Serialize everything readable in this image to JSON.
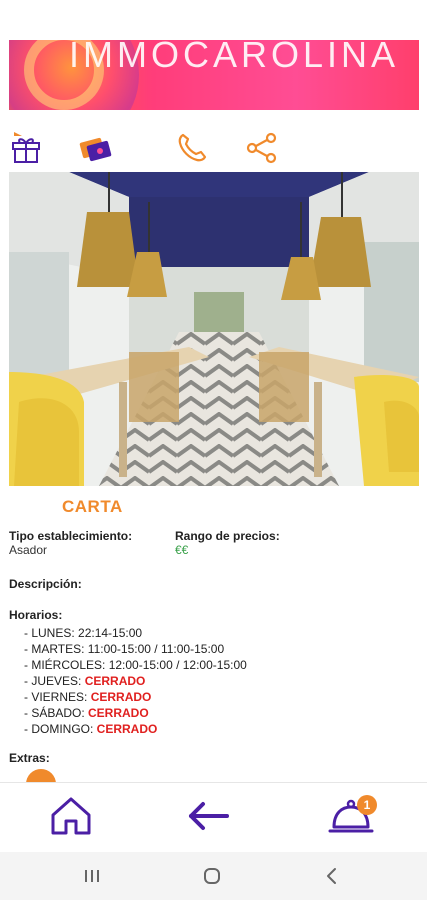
{
  "banner": {
    "brand_text": "IMMOCAROLINA"
  },
  "actions": {
    "gift_icon": "gift-icon",
    "cards_icon": "loyalty-card-icon",
    "phone_icon": "phone-icon",
    "share_icon": "share-icon"
  },
  "section_title": "CARTA",
  "details": {
    "type_label": "Tipo establecimiento:",
    "type_value": "Asador",
    "price_label": "Rango de precios:",
    "price_value": "€€",
    "description_label": "Descripción:",
    "hours_label": "Horarios:",
    "hours": [
      {
        "day": "- LUNES: ",
        "time": "22:14-15:00",
        "closed": ""
      },
      {
        "day": "- MARTES: ",
        "time": "11:00-15:00 / 11:00-15:00",
        "closed": ""
      },
      {
        "day": "- MIÉRCOLES: ",
        "time": "12:00-15:00 / 12:00-15:00",
        "closed": ""
      },
      {
        "day": "- JUEVES: ",
        "time": "",
        "closed": "CERRADO"
      },
      {
        "day": "- VIERNES: ",
        "time": "",
        "closed": "CERRADO"
      },
      {
        "day": "- SÁBADO: ",
        "time": "",
        "closed": "CERRADO"
      },
      {
        "day": "- DOMINGO: ",
        "time": "",
        "closed": "CERRADO"
      }
    ],
    "extras_label": "Extras:"
  },
  "bottom_nav": {
    "home_icon": "home-icon",
    "back_icon": "back-arrow-icon",
    "orders_icon": "service-bell-icon",
    "orders_badge": "1"
  },
  "colors": {
    "accent": "#f08a2c",
    "nav_purple": "#4b1fa5",
    "closed_red": "#e0201f",
    "price_green": "#3aa14a"
  }
}
